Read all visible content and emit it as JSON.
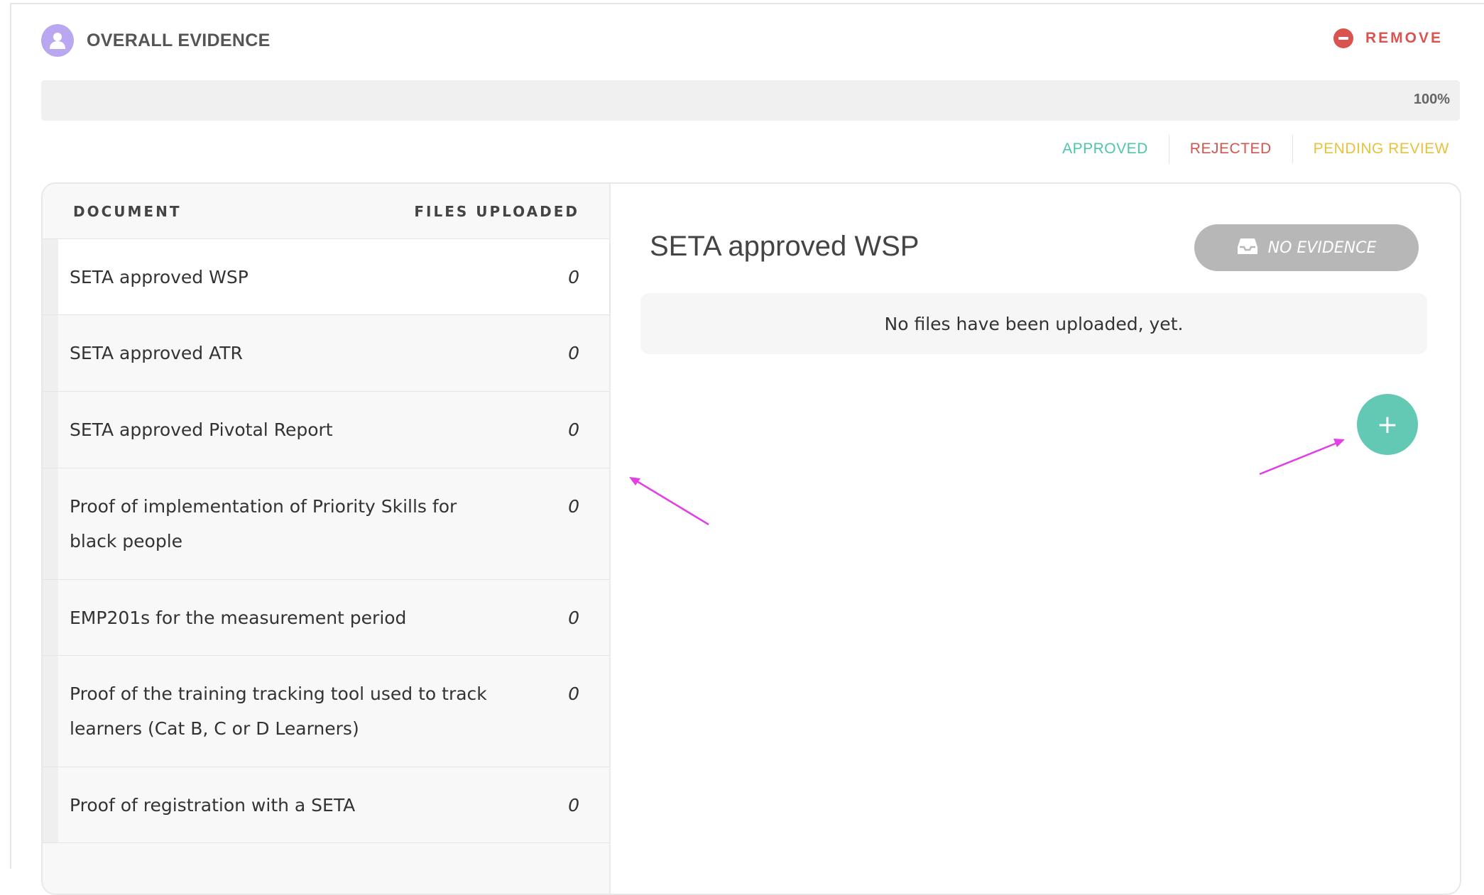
{
  "header": {
    "title": "OVERALL EVIDENCE",
    "avatar_icon": "user-icon",
    "remove_label": "REMOVE",
    "remove_icon": "minus-circle-icon"
  },
  "progress": {
    "value": 100,
    "label": "100%"
  },
  "legend": {
    "approved": "APPROVED",
    "rejected": "REJECTED",
    "pending": "PENDING REVIEW"
  },
  "colors": {
    "approved": "#4fc4ae",
    "rejected": "#d2564f",
    "pending": "#e8c23c",
    "avatar": "#b9a7ef",
    "add_button": "#64c9b4",
    "annotation_arrow": "#e040e6"
  },
  "table": {
    "col_document": "DOCUMENT",
    "col_files": "FILES UPLOADED",
    "rows": [
      {
        "label": "SETA approved WSP",
        "count": "0",
        "active": true
      },
      {
        "label": "SETA approved ATR",
        "count": "0"
      },
      {
        "label": "SETA approved Pivotal Report",
        "count": "0"
      },
      {
        "label": "Proof of implementation of Priority Skills for black people",
        "count": "0"
      },
      {
        "label": "EMP201s for the measurement period",
        "count": "0"
      },
      {
        "label": "Proof of the training tracking tool used to track learners (Cat B, C or D Learners)",
        "count": "0"
      },
      {
        "label": "Proof of registration with a SETA",
        "count": "0"
      }
    ]
  },
  "detail": {
    "title": "SETA approved WSP",
    "status_label": "NO EVIDENCE",
    "status_icon": "inbox-icon",
    "empty_message": "No files have been uploaded, yet.",
    "add_icon": "plus-icon",
    "add_symbol": "+"
  }
}
